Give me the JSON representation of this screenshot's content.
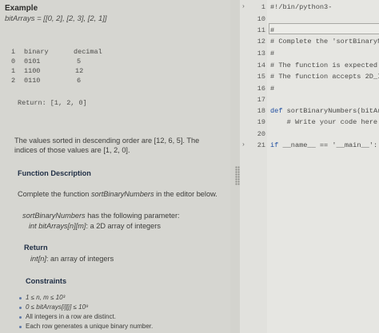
{
  "problem": {
    "example_title": "Example",
    "example_input": "bitArrays = [[0, 2], [2, 3], [2, 1]]",
    "table_headers": [
      "i",
      "binary",
      "decimal"
    ],
    "table_rows": [
      [
        "0",
        "0101",
        "5"
      ],
      [
        "1",
        "1100",
        "12"
      ],
      [
        "2",
        "0110",
        "6"
      ]
    ],
    "return_line": "Return: [1, 2, 0]",
    "explanation": "The values sorted in descending order are [12, 6, 5]. The indices of those values are [1, 2, 0].",
    "function_description_title": "Function Description",
    "function_description_prefix": "Complete the function ",
    "function_name": "sortBinaryNumbers",
    "function_description_suffix": " in the editor below.",
    "params_prefix_name": "sortBinaryNumbers",
    "params_suffix": " has the following parameter:",
    "param_type": "int bitArrays[n][m]",
    "param_desc": ": a 2D array of integers",
    "return_title": "Return",
    "return_type": "int[n]",
    "return_desc": ": an array of integers",
    "constraints_title": "Constraints",
    "constraints": [
      "1 ≤ n, m ≤ 10³",
      "0 ≤ bitArrays[i][j] ≤ 10⁹",
      "All integers in a row are distinct.",
      "Each row generates a unique binary number."
    ]
  },
  "editor": {
    "lines": [
      {
        "num": "1",
        "fold": "›",
        "code": "#!/bin/python3-"
      },
      {
        "num": "10",
        "fold": "",
        "code": ""
      },
      {
        "num": "11",
        "fold": "",
        "code": "#"
      },
      {
        "num": "12",
        "fold": "",
        "code": "# Complete the 'sortBinaryNumbers'"
      },
      {
        "num": "13",
        "fold": "",
        "code": "#"
      },
      {
        "num": "14",
        "fold": "",
        "code": "# The function is expected to"
      },
      {
        "num": "15",
        "fold": "",
        "code": "# The function accepts 2D_INT"
      },
      {
        "num": "16",
        "fold": "",
        "code": "#"
      },
      {
        "num": "17",
        "fold": "",
        "code": ""
      },
      {
        "num": "18",
        "fold": "",
        "code_kw": "def",
        "code": " sortBinaryNumbers(bitArrays):"
      },
      {
        "num": "19",
        "fold": "",
        "code": "    # Write your code here"
      },
      {
        "num": "20",
        "fold": "",
        "code": ""
      },
      {
        "num": "21",
        "fold": "›",
        "code_kw": "if",
        "code": " __name__ == '__main__':"
      }
    ]
  }
}
